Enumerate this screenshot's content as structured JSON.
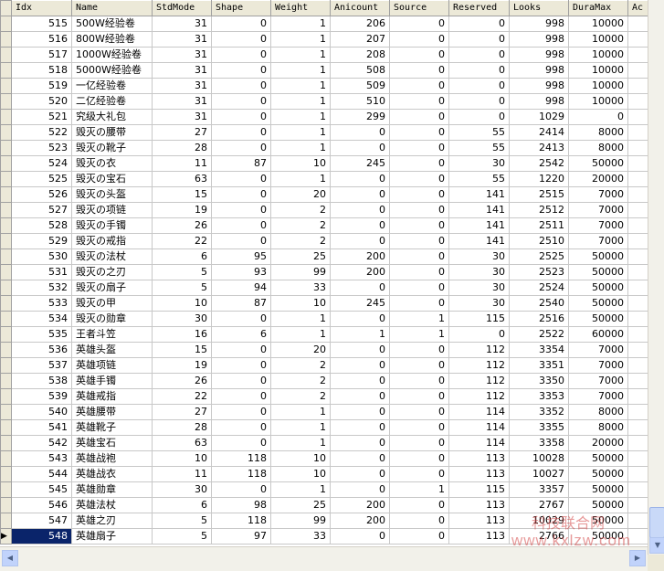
{
  "columns": [
    "Idx",
    "Name",
    "StdMode",
    "Shape",
    "Weight",
    "Anicount",
    "Source",
    "Reserved",
    "Looks",
    "DuraMax",
    "Ac"
  ],
  "selected_idx": "548",
  "row_pointer_glyph": "▶",
  "rows": [
    [
      "515",
      "500W经验卷",
      "31",
      "0",
      "1",
      "206",
      "0",
      "0",
      "998",
      "10000",
      ""
    ],
    [
      "516",
      "800W经验卷",
      "31",
      "0",
      "1",
      "207",
      "0",
      "0",
      "998",
      "10000",
      ""
    ],
    [
      "517",
      "1000W经验卷",
      "31",
      "0",
      "1",
      "208",
      "0",
      "0",
      "998",
      "10000",
      ""
    ],
    [
      "518",
      "5000W经验卷",
      "31",
      "0",
      "1",
      "508",
      "0",
      "0",
      "998",
      "10000",
      ""
    ],
    [
      "519",
      "一亿经验卷",
      "31",
      "0",
      "1",
      "509",
      "0",
      "0",
      "998",
      "10000",
      ""
    ],
    [
      "520",
      "二亿经验卷",
      "31",
      "0",
      "1",
      "510",
      "0",
      "0",
      "998",
      "10000",
      ""
    ],
    [
      "521",
      "究级大礼包",
      "31",
      "0",
      "1",
      "299",
      "0",
      "0",
      "1029",
      "0",
      ""
    ],
    [
      "522",
      "毁灭の腰带",
      "27",
      "0",
      "1",
      "0",
      "0",
      "55",
      "2414",
      "8000",
      ""
    ],
    [
      "523",
      "毁灭の靴子",
      "28",
      "0",
      "1",
      "0",
      "0",
      "55",
      "2413",
      "8000",
      ""
    ],
    [
      "524",
      "毁灭の衣",
      "11",
      "87",
      "10",
      "245",
      "0",
      "30",
      "2542",
      "50000",
      ""
    ],
    [
      "525",
      "毁灭の宝石",
      "63",
      "0",
      "1",
      "0",
      "0",
      "55",
      "1220",
      "20000",
      ""
    ],
    [
      "526",
      "毁灭の头盔",
      "15",
      "0",
      "20",
      "0",
      "0",
      "141",
      "2515",
      "7000",
      ""
    ],
    [
      "527",
      "毁灭の项链",
      "19",
      "0",
      "2",
      "0",
      "0",
      "141",
      "2512",
      "7000",
      ""
    ],
    [
      "528",
      "毁灭の手镯",
      "26",
      "0",
      "2",
      "0",
      "0",
      "141",
      "2511",
      "7000",
      ""
    ],
    [
      "529",
      "毁灭の戒指",
      "22",
      "0",
      "2",
      "0",
      "0",
      "141",
      "2510",
      "7000",
      ""
    ],
    [
      "530",
      "毁灭の法杖",
      "6",
      "95",
      "25",
      "200",
      "0",
      "30",
      "2525",
      "50000",
      ""
    ],
    [
      "531",
      "毁灭の之刃",
      "5",
      "93",
      "99",
      "200",
      "0",
      "30",
      "2523",
      "50000",
      ""
    ],
    [
      "532",
      "毁灭の扇子",
      "5",
      "94",
      "33",
      "0",
      "0",
      "30",
      "2524",
      "50000",
      ""
    ],
    [
      "533",
      "毁灭の甲",
      "10",
      "87",
      "10",
      "245",
      "0",
      "30",
      "2540",
      "50000",
      ""
    ],
    [
      "534",
      "毁灭の勋章",
      "30",
      "0",
      "1",
      "0",
      "1",
      "115",
      "2516",
      "50000",
      ""
    ],
    [
      "535",
      "王者斗笠",
      "16",
      "6",
      "1",
      "1",
      "1",
      "0",
      "2522",
      "60000",
      ""
    ],
    [
      "536",
      "英雄头盔",
      "15",
      "0",
      "20",
      "0",
      "0",
      "112",
      "3354",
      "7000",
      ""
    ],
    [
      "537",
      "英雄项链",
      "19",
      "0",
      "2",
      "0",
      "0",
      "112",
      "3351",
      "7000",
      ""
    ],
    [
      "538",
      "英雄手镯",
      "26",
      "0",
      "2",
      "0",
      "0",
      "112",
      "3350",
      "7000",
      ""
    ],
    [
      "539",
      "英雄戒指",
      "22",
      "0",
      "2",
      "0",
      "0",
      "112",
      "3353",
      "7000",
      ""
    ],
    [
      "540",
      "英雄腰带",
      "27",
      "0",
      "1",
      "0",
      "0",
      "114",
      "3352",
      "8000",
      ""
    ],
    [
      "541",
      "英雄靴子",
      "28",
      "0",
      "1",
      "0",
      "0",
      "114",
      "3355",
      "8000",
      ""
    ],
    [
      "542",
      "英雄宝石",
      "63",
      "0",
      "1",
      "0",
      "0",
      "114",
      "3358",
      "20000",
      ""
    ],
    [
      "543",
      "英雄战袍",
      "10",
      "118",
      "10",
      "0",
      "0",
      "113",
      "10028",
      "50000",
      ""
    ],
    [
      "544",
      "英雄战衣",
      "11",
      "118",
      "10",
      "0",
      "0",
      "113",
      "10027",
      "50000",
      ""
    ],
    [
      "545",
      "英雄勋章",
      "30",
      "0",
      "1",
      "0",
      "1",
      "115",
      "3357",
      "50000",
      ""
    ],
    [
      "546",
      "英雄法杖",
      "6",
      "98",
      "25",
      "200",
      "0",
      "113",
      "2767",
      "50000",
      ""
    ],
    [
      "547",
      "英雄之刃",
      "5",
      "118",
      "99",
      "200",
      "0",
      "113",
      "10029",
      "50000",
      ""
    ],
    [
      "548",
      "英雄扇子",
      "5",
      "97",
      "33",
      "0",
      "0",
      "113",
      "2766",
      "50000",
      ""
    ]
  ],
  "watermark": {
    "line1": "科技联合网",
    "line2": "www.kxlzw.com"
  },
  "colors": {
    "selection": "#0a246a",
    "header_bg": "#ece9d8"
  }
}
